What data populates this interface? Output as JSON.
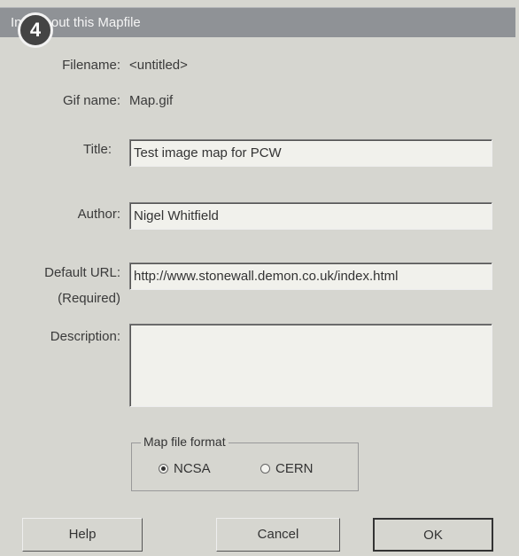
{
  "window": {
    "title": "Info about this Mapfile",
    "step_badge": "4"
  },
  "info": {
    "filename_label": "Filename:",
    "filename_value": "<untitled>",
    "gifname_label": "Gif name:",
    "gifname_value": "Map.gif"
  },
  "form": {
    "title_label": "Title:",
    "title_value": "Test image map for PCW",
    "author_label": "Author:",
    "author_value": "Nigel Whitfield",
    "url_label": "Default URL:",
    "url_sublabel": "(Required)",
    "url_value": "http://www.stonewall.demon.co.uk/index.html",
    "description_label": "Description:",
    "description_value": ""
  },
  "format": {
    "group_title": "Map file format",
    "options": [
      {
        "label": "NCSA",
        "selected": true
      },
      {
        "label": "CERN",
        "selected": false
      }
    ]
  },
  "buttons": {
    "help": "Help",
    "cancel": "Cancel",
    "ok": "OK"
  }
}
